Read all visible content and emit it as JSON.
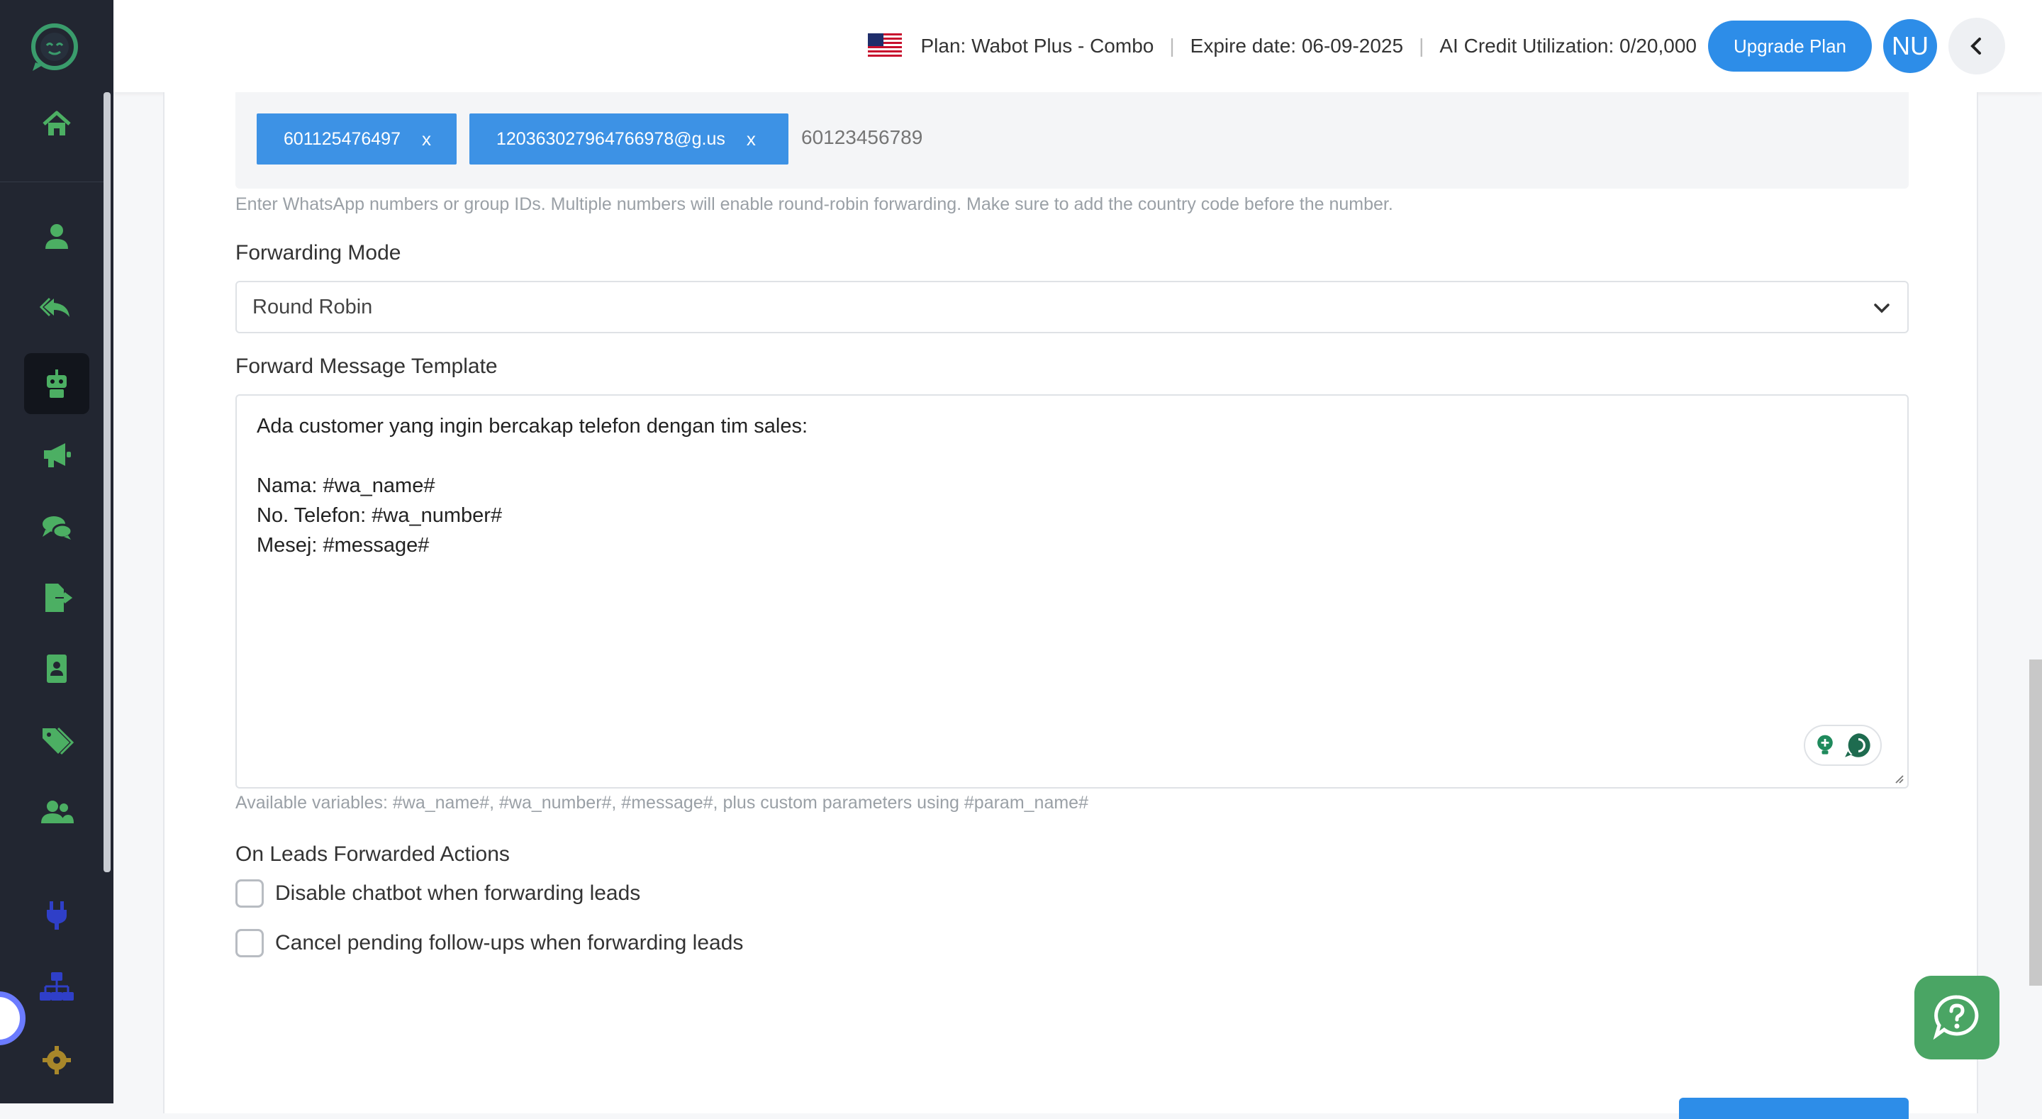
{
  "header": {
    "plan_text": "Plan: Wabot Plus - Combo",
    "separator": "|",
    "expire_text": "Expire date: 06-09-2025",
    "ai_credit_text": "AI Credit Utilization: 0/20,000",
    "upgrade_label": "Upgrade Plan",
    "avatar_initials": "NU",
    "flag_icon": "us-flag-icon",
    "collapse_icon": "chevron-left-icon"
  },
  "sidebar": {
    "items": [
      {
        "name": "home",
        "icon": "home-icon"
      },
      {
        "name": "contacts",
        "icon": "user-icon"
      },
      {
        "name": "auto-reply",
        "icon": "reply-icon"
      },
      {
        "name": "chatbot",
        "icon": "robot-icon",
        "active": true
      },
      {
        "name": "broadcast",
        "icon": "megaphone-icon"
      },
      {
        "name": "chats",
        "icon": "chat-icon"
      },
      {
        "name": "export",
        "icon": "file-export-icon"
      },
      {
        "name": "address-book",
        "icon": "address-book-icon"
      },
      {
        "name": "tags",
        "icon": "tags-icon"
      },
      {
        "name": "team",
        "icon": "users-icon"
      },
      {
        "name": "integrations",
        "icon": "plug-icon"
      },
      {
        "name": "workflow",
        "icon": "sitemap-icon"
      },
      {
        "name": "settings",
        "icon": "gear-icon"
      }
    ]
  },
  "forward_to": {
    "tags": [
      "601125476497",
      "120363027964766978@g.us"
    ],
    "remove_label": "x",
    "placeholder": "60123456789",
    "help": "Enter WhatsApp numbers or group IDs. Multiple numbers will enable round-robin forwarding. Make sure to add the country code before the number."
  },
  "forwarding_mode": {
    "label": "Forwarding Mode",
    "selected": "Round Robin"
  },
  "template": {
    "label": "Forward Message Template",
    "lines": [
      "Ada customer yang ingin bercakap telefon dengan tim sales:",
      "",
      "Nama: #wa_name#",
      "No. Telefon: #wa_number#",
      "Mesej: #message#"
    ],
    "help": "Available variables: #wa_name#, #wa_number#, #message#, plus custom parameters using #param_name#"
  },
  "actions": {
    "label": "On Leads Forwarded Actions",
    "options": [
      {
        "label": "Disable chatbot when forwarding leads",
        "checked": false
      },
      {
        "label": "Cancel pending follow-ups when forwarding leads",
        "checked": false
      }
    ]
  },
  "colors": {
    "sidebar_bg": "#222631",
    "accent_green": "#4aa564",
    "primary_blue": "#2d8de8"
  }
}
